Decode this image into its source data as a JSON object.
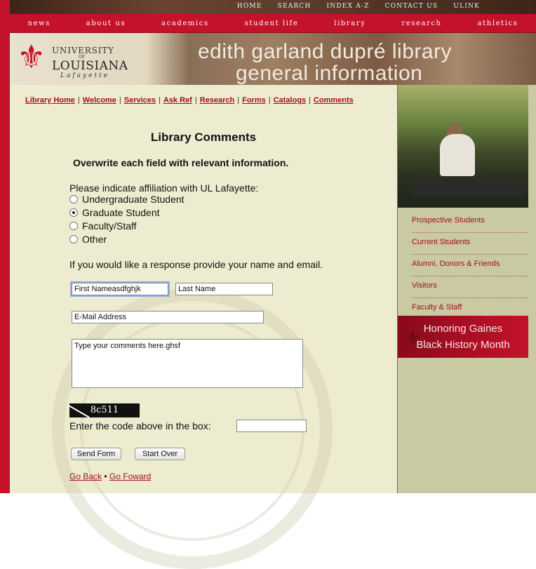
{
  "utility_links": [
    "HOME",
    "SEARCH",
    "INDEX A-Z",
    "CONTACT US",
    "ULINK"
  ],
  "main_nav": [
    "news",
    "about us",
    "academics",
    "student life",
    "library",
    "research",
    "athletics"
  ],
  "logo": {
    "line1": "UNIVERSITY",
    "of": "OF",
    "line2": "LOUISIANA",
    "line3": "Lafayette"
  },
  "banner": {
    "title_line1": "edith garland dupré library",
    "title_line2": "general information"
  },
  "library_links": [
    "Library Home",
    "Welcome",
    "Services",
    "Ask Ref",
    "Research",
    "Forms",
    "Catalogs",
    "Comments"
  ],
  "form": {
    "heading": "Library Comments",
    "instruction": "Overwrite each field with relevant information.",
    "affiliation_prompt": "Please indicate affiliation with UL Lafayette:",
    "affiliations": [
      {
        "label": "Undergraduate Student",
        "selected": false
      },
      {
        "label": "Graduate Student",
        "selected": true
      },
      {
        "label": "Faculty/Staff",
        "selected": false
      },
      {
        "label": "Other",
        "selected": false
      }
    ],
    "response_prompt": "If you would like a response provide your name and email.",
    "first_name": "First Nameasdfghjk",
    "last_name": "Last Name",
    "email": "E-Mail Address",
    "comments": "Type your comments here.ghsf",
    "captcha_text": "8c511",
    "code_prompt": "Enter the code above in the box:",
    "code_value": "",
    "send_label": "Send Form",
    "reset_label": "Start Over",
    "go_back": "Go Back",
    "bullet": "•",
    "go_forward": "Go Foward"
  },
  "sidebar": {
    "menu": [
      "Prospective Students",
      "Current Students",
      "Alumni, Donors & Friends",
      "Visitors",
      "Faculty & Staff"
    ],
    "promo_line1": "Honoring Gaines",
    "promo_line2": "Black History Month"
  },
  "colors": {
    "brand_red": "#c4122a",
    "content_bg": "#eeecd0",
    "sidebar_bg": "#c9c9a2"
  }
}
